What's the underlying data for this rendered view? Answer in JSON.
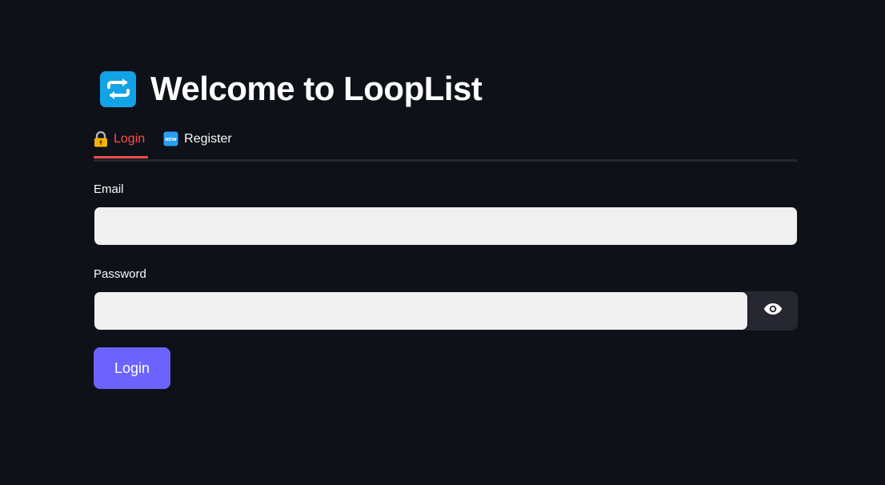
{
  "app": {
    "title": "Welcome to LoopList",
    "logo_icon": "repeat-arrows-icon",
    "logo_color": "#12a3e6"
  },
  "tabs": [
    {
      "label": "Login",
      "icon": "locked-with-key-icon",
      "active": true
    },
    {
      "label": "Register",
      "icon": "new-badge-icon",
      "active": false
    }
  ],
  "form": {
    "email_label": "Email",
    "email_value": "",
    "password_label": "Password",
    "password_value": "",
    "toggle_icon": "eye-icon",
    "submit_label": "Login"
  },
  "colors": {
    "background": "#0e1118",
    "accent_active_tab": "#ff4b4b",
    "primary_button": "#6c63ff",
    "input_background": "#f0f0f0"
  }
}
